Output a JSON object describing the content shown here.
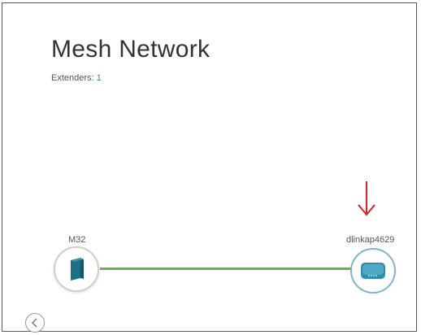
{
  "header": {
    "title": "Mesh Network",
    "extenders_label": "Extenders:",
    "extenders_count": "1"
  },
  "nodes": [
    {
      "label": "M32",
      "icon": "router-icon"
    },
    {
      "label": "dlinkap4629",
      "icon": "extender-icon"
    }
  ],
  "annotation": {
    "icon": "red-arrow-down-icon",
    "color": "#e02020"
  },
  "navigation": {
    "back_icon": "chevron-left-icon"
  },
  "colors": {
    "link": "#6ab04c",
    "accent": "#2a8fa8",
    "extender_ring": "#7fb6c6"
  }
}
